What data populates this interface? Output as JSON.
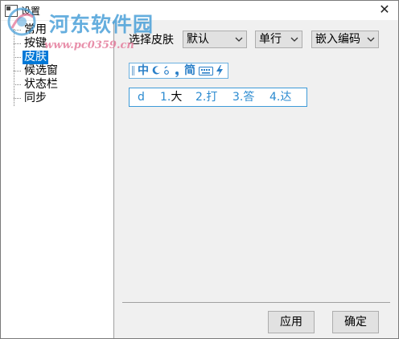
{
  "window": {
    "title": "设置",
    "close_glyph": "✕"
  },
  "watermark": {
    "title": "河东软件园",
    "url": "www.pc0359.cn"
  },
  "tree": {
    "items": [
      {
        "label": "常用",
        "selected": false
      },
      {
        "label": "按键",
        "selected": false
      },
      {
        "label": "皮肤",
        "selected": true
      },
      {
        "label": "候选窗",
        "selected": false
      },
      {
        "label": "状态栏",
        "selected": false
      },
      {
        "label": "同步",
        "selected": false
      }
    ]
  },
  "skin": {
    "label": "选择皮肤",
    "skin_select": {
      "value": "默认"
    },
    "row_select": {
      "value": "单行"
    },
    "encode_select": {
      "value": "嵌入编码"
    }
  },
  "status_toolbar": {
    "mode": "中",
    "charset": "简"
  },
  "candidate": {
    "code": "d",
    "items": [
      {
        "index": "1.",
        "char": "大"
      },
      {
        "index": "2.",
        "char": "打"
      },
      {
        "index": "3.",
        "char": "答"
      },
      {
        "index": "4.",
        "char": "达"
      }
    ]
  },
  "buttons": {
    "apply": "应用",
    "ok": "确定"
  },
  "colors": {
    "selection": "#0078d7",
    "skin_accent": "#2a7fc8",
    "watermark_blue": "#3f9ad6",
    "watermark_pink": "#e57c9c"
  }
}
